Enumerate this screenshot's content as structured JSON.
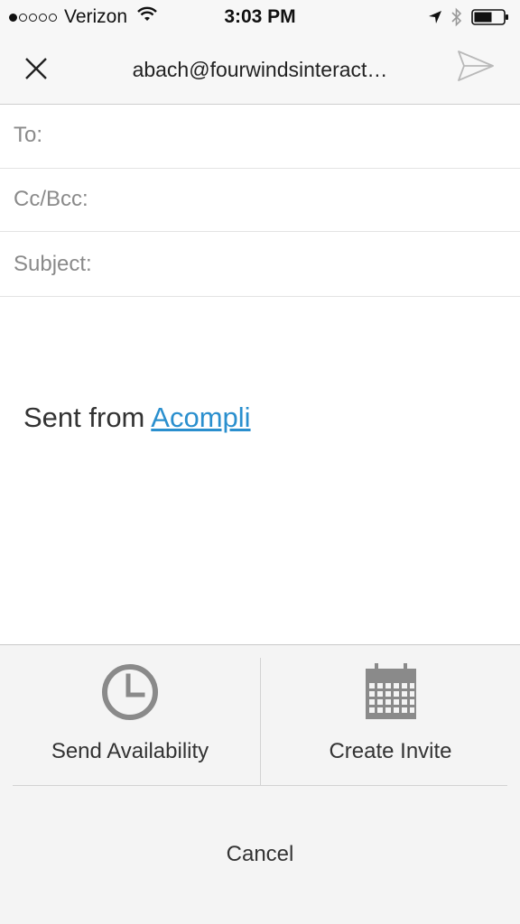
{
  "status_bar": {
    "carrier": "Verizon",
    "time": "3:03 PM",
    "signal_bars_filled": 1,
    "signal_bars_total": 5
  },
  "nav": {
    "title": "abach@fourwindsinteract…",
    "close_icon": "close-icon",
    "send_icon": "send-icon"
  },
  "compose": {
    "to_label": "To:",
    "cc_label": "Cc/Bcc:",
    "subject_label": "Subject:",
    "signature_prefix": "Sent from ",
    "signature_link": "Acompli"
  },
  "action_sheet": {
    "send_availability_label": "Send Availability",
    "send_availability_icon": "clock-icon",
    "create_invite_label": "Create Invite",
    "create_invite_icon": "calendar-icon",
    "cancel_label": "Cancel"
  },
  "colors": {
    "link": "#2a8fce",
    "icon_gray": "#8a8a8a",
    "sheet_background": "#f4f4f4"
  }
}
